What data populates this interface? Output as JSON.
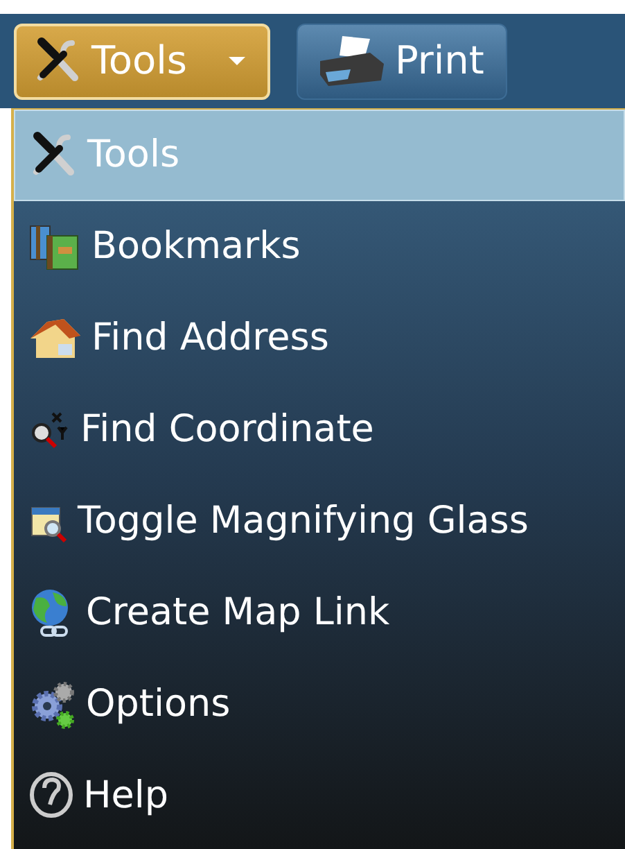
{
  "toolbar": {
    "buttons": [
      {
        "label": "Tools",
        "selected": true,
        "has_dropdown": true
      },
      {
        "label": "Print",
        "selected": false,
        "has_dropdown": false
      }
    ]
  },
  "menu": {
    "items": [
      {
        "label": "Tools",
        "selected": true
      },
      {
        "label": "Bookmarks",
        "selected": false
      },
      {
        "label": "Find Address",
        "selected": false
      },
      {
        "label": "Find Coordinate",
        "selected": false
      },
      {
        "label": "Toggle Magnifying Glass",
        "selected": false
      },
      {
        "label": "Create Map Link",
        "selected": false
      },
      {
        "label": "Options",
        "selected": false
      },
      {
        "label": "Help",
        "selected": false
      }
    ]
  }
}
